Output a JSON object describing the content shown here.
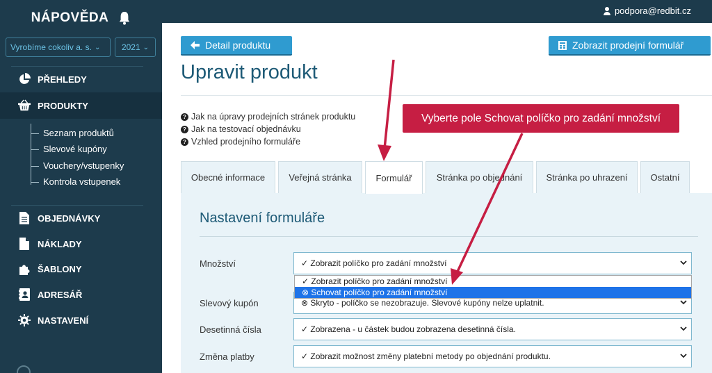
{
  "sidebar": {
    "brand": "NÁPOVĚDA",
    "company_select": "Vyrobíme cokoliv a. s.",
    "year_select": "2021",
    "nav": {
      "prehledy": "PŘEHLEDY",
      "produkty": "PRODUKTY",
      "objednavky": "OBJEDNÁVKY",
      "naklady": "NÁKLADY",
      "sablony": "ŠABLONY",
      "adresar": "ADRESÁŘ",
      "nastaveni": "NASTAVENÍ"
    },
    "sub": [
      "Seznam produktů",
      "Slevové kupóny",
      "Vouchery/vstupenky",
      "Kontrola vstupenek"
    ]
  },
  "topbar": {
    "user": "podpora@redbit.cz"
  },
  "buttons": {
    "back": "Detail produktu",
    "show_form": "Zobrazit prodejní formulář"
  },
  "page": {
    "title": "Upravit produkt"
  },
  "help_links": [
    "Jak na úpravy prodejních stránek produktu",
    "Jak na testovací objednávku",
    "Vzhled prodejního formuláře"
  ],
  "tabs": [
    "Obecné informace",
    "Veřejná stránka",
    "Formulář",
    "Stránka po objednání",
    "Stránka po uhrazení",
    "Ostatní"
  ],
  "form": {
    "section_title": "Nastavení formuláře",
    "rows": [
      {
        "label": "Množství",
        "value": "✓ Zobrazit políčko pro zadání množství"
      },
      {
        "label": "Slevový kupón",
        "value": "⊗ Skryto - políčko se nezobrazuje. Slevové kupóny nelze uplatnit."
      },
      {
        "label": "Desetinná čísla",
        "value": "✓ Zobrazena - u částek budou zobrazena desetinná čísla."
      },
      {
        "label": "Změna platby",
        "value": "✓ Zobrazit možnost změny platební metody po objednání produktu."
      }
    ],
    "dropdown_options": [
      "✓ Zobrazit políčko pro zadání množství",
      "⊗ Schovat políčko pro zadání množství"
    ]
  },
  "callout": "Vyberte pole Schovat políčko pro zadání množství",
  "colors": {
    "sidebar": "#1d3b4c",
    "accent": "#2f9bd0",
    "callout": "#c61e43",
    "title": "#1d5a76"
  }
}
